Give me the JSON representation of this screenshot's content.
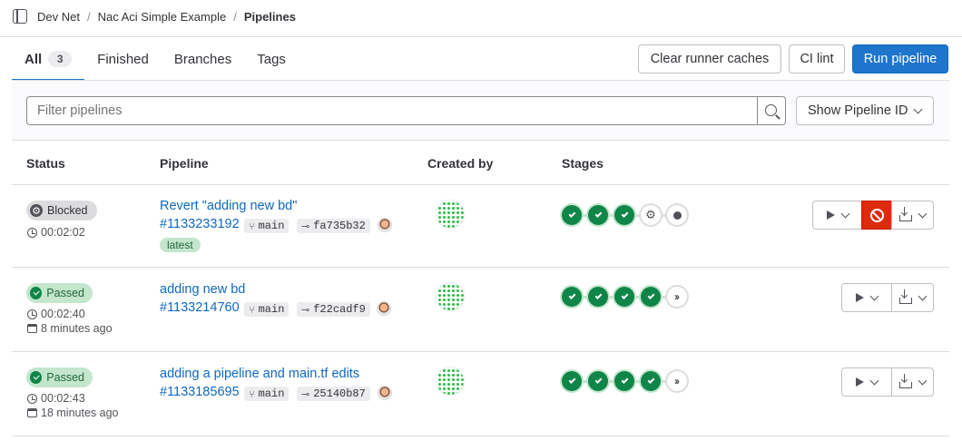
{
  "breadcrumb": {
    "items": [
      "Dev Net",
      "Nac Aci Simple Example",
      "Pipelines"
    ],
    "separator": "/"
  },
  "tabs": [
    {
      "label": "All",
      "count": "3",
      "active": true
    },
    {
      "label": "Finished"
    },
    {
      "label": "Branches"
    },
    {
      "label": "Tags"
    }
  ],
  "actions": {
    "clear_caches": "Clear runner caches",
    "ci_lint": "CI lint",
    "run_pipeline": "Run pipeline"
  },
  "filter": {
    "placeholder": "Filter pipelines",
    "show_id_label": "Show Pipeline ID"
  },
  "table": {
    "headers": {
      "status": "Status",
      "pipeline": "Pipeline",
      "created_by": "Created by",
      "stages": "Stages"
    }
  },
  "pipelines": [
    {
      "status": "Blocked",
      "duration": "00:02:02",
      "finished": "",
      "title": "Revert \"adding new bd\"",
      "id": "#1133233192",
      "branch": "main",
      "commit": "fa735b32",
      "tag": "latest",
      "stages": [
        "success",
        "success",
        "success",
        "manual",
        "created"
      ]
    },
    {
      "status": "Passed",
      "duration": "00:02:40",
      "finished": "8 minutes ago",
      "title": "adding new bd",
      "id": "#1133214760",
      "branch": "main",
      "commit": "f22cadf9",
      "stages": [
        "success",
        "success",
        "success",
        "success",
        "skipped"
      ]
    },
    {
      "status": "Passed",
      "duration": "00:02:43",
      "finished": "18 minutes ago",
      "title": "adding a pipeline and main.tf edits",
      "id": "#1133185695",
      "branch": "main",
      "commit": "25140b87",
      "stages": [
        "success",
        "success",
        "success",
        "success",
        "skipped"
      ]
    }
  ],
  "icons": {
    "sidebar": "sidebar-toggle-icon",
    "search": "search-icon",
    "chevron": "chevron-down-icon",
    "play": "play-icon",
    "cancel": "cancel-icon",
    "download": "download-icon",
    "clock": "clock-icon",
    "calendar": "calendar-icon",
    "branch": "branch-icon",
    "commit": "commit-icon"
  },
  "colors": {
    "primary": "#1f75cb",
    "success": "#108548",
    "danger": "#dd2b0e",
    "link": "#1068bf"
  }
}
